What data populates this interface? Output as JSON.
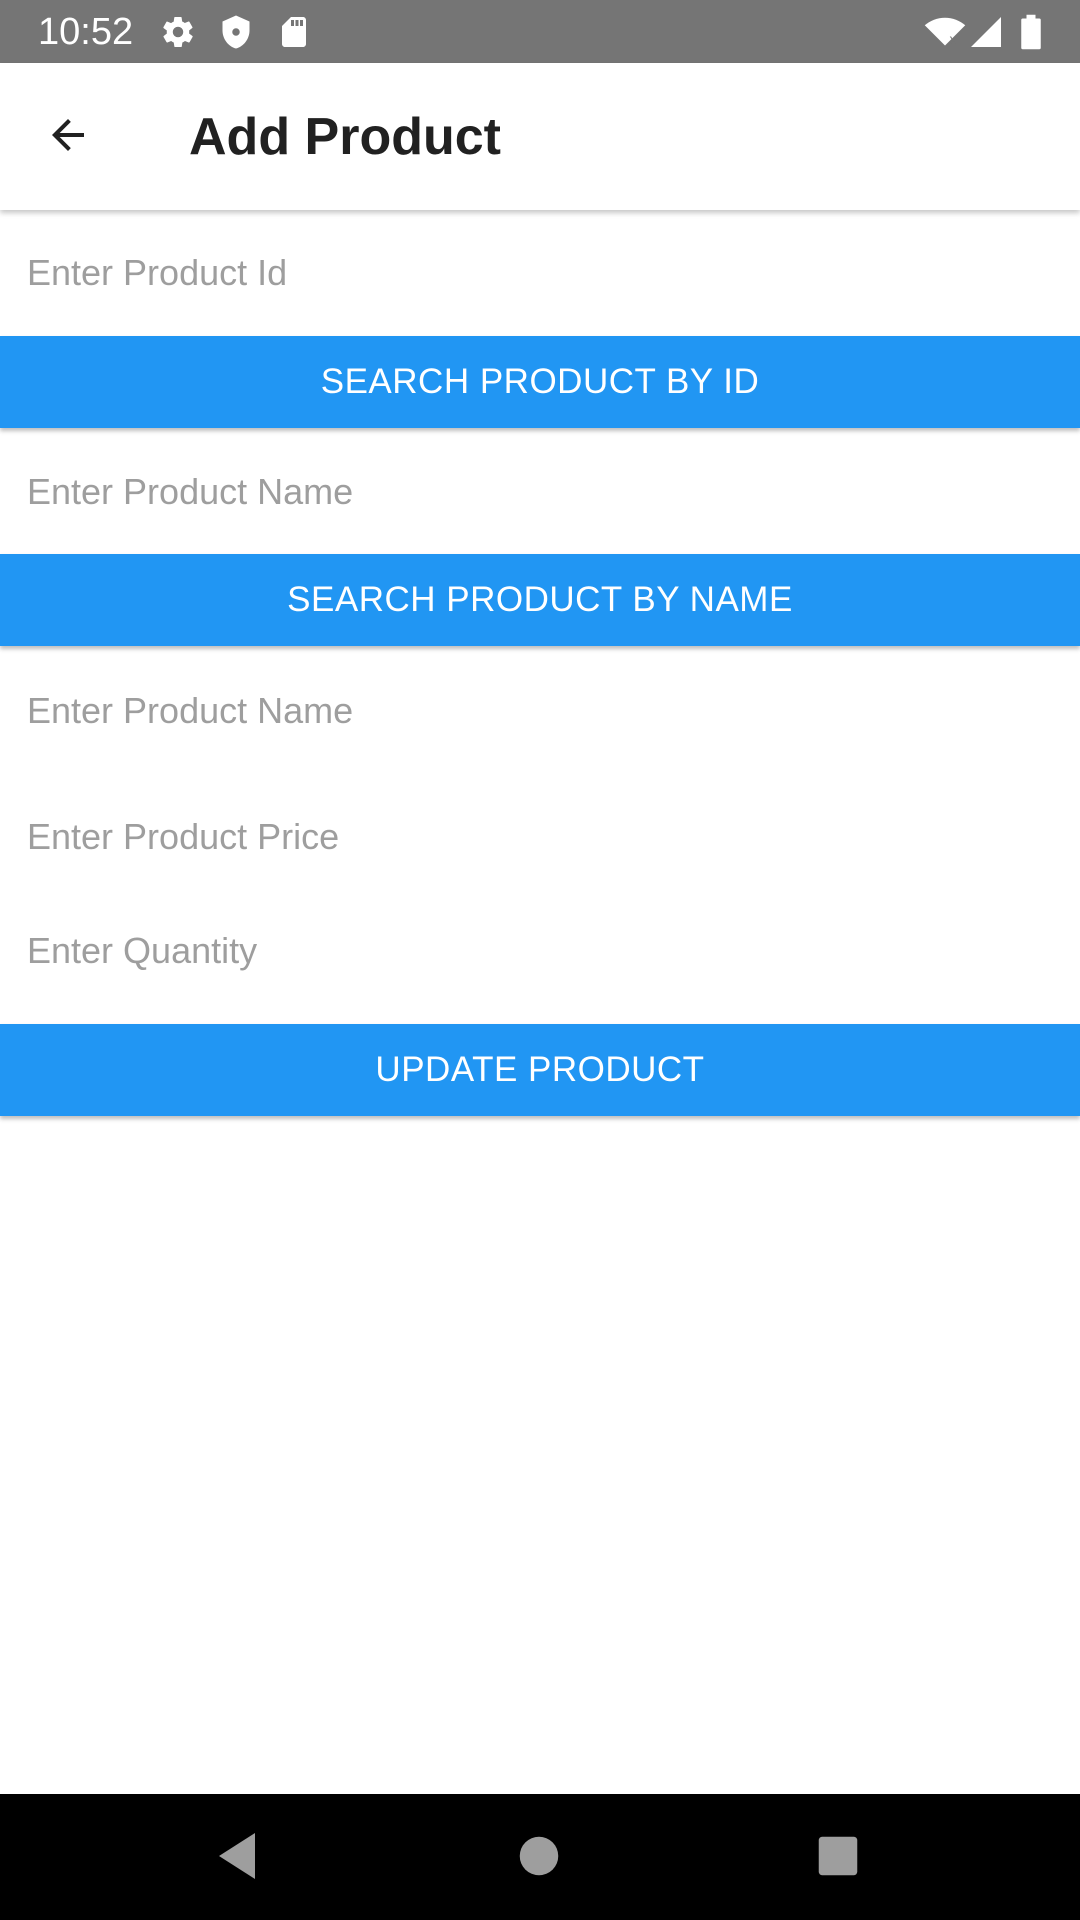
{
  "status_bar": {
    "time": "10:52",
    "left_icons": [
      "gear-icon",
      "shield-icon",
      "sd-card-icon"
    ],
    "right_icons": [
      "wifi-icon",
      "signal-icon",
      "battery-icon"
    ],
    "background": "#757575"
  },
  "app_bar": {
    "title": "Add Product",
    "back_icon": "arrow-left-icon"
  },
  "form": {
    "product_id": {
      "placeholder": "Enter Product Id",
      "value": ""
    },
    "search_by_id_label": "SEARCH PRODUCT BY ID",
    "search_name": {
      "placeholder": "Enter Product Name",
      "value": ""
    },
    "search_by_name_label": "SEARCH PRODUCT BY NAME",
    "product_name": {
      "placeholder": "Enter Product Name",
      "value": ""
    },
    "product_price": {
      "placeholder": "Enter Product Price",
      "value": ""
    },
    "quantity": {
      "placeholder": "Enter Quantity",
      "value": ""
    },
    "update_label": "UPDATE PRODUCT"
  },
  "nav_bar": {
    "buttons": [
      "back-triangle-icon",
      "home-circle-icon",
      "recents-square-icon"
    ]
  },
  "colors": {
    "accent": "#2196F3",
    "placeholder": "#9e9e9e",
    "title": "#212121"
  }
}
